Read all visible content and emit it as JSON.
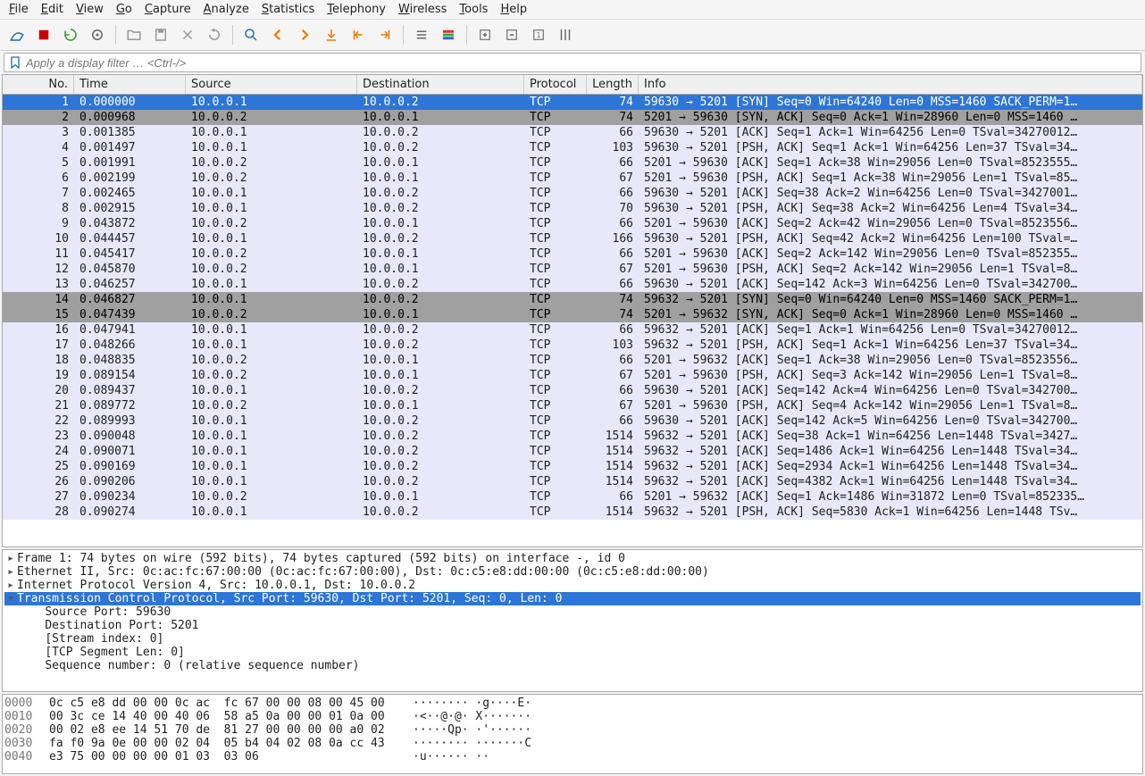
{
  "menubar": [
    "File",
    "Edit",
    "View",
    "Go",
    "Capture",
    "Analyze",
    "Statistics",
    "Telephony",
    "Wireless",
    "Tools",
    "Help"
  ],
  "filter_placeholder": "Apply a display filter … <Ctrl-/>",
  "columns": {
    "no": "No.",
    "time": "Time",
    "source": "Source",
    "destination": "Destination",
    "protocol": "Protocol",
    "length": "Length",
    "info": "Info"
  },
  "packets": [
    {
      "no": 1,
      "time": "0.000000",
      "src": "10.0.0.1",
      "dst": "10.0.0.2",
      "proto": "TCP",
      "len": 74,
      "info": "59630 → 5201 [SYN] Seq=0 Win=64240 Len=0 MSS=1460 SACK_PERM=1…",
      "style": "selected"
    },
    {
      "no": 2,
      "time": "0.000968",
      "src": "10.0.0.2",
      "dst": "10.0.0.1",
      "proto": "TCP",
      "len": 74,
      "info": "5201 → 59630 [SYN, ACK] Seq=0 Ack=1 Win=28960 Len=0 MSS=1460 …",
      "style": "syn"
    },
    {
      "no": 3,
      "time": "0.001385",
      "src": "10.0.0.1",
      "dst": "10.0.0.2",
      "proto": "TCP",
      "len": 66,
      "info": "59630 → 5201 [ACK] Seq=1 Ack=1 Win=64256 Len=0 TSval=34270012…",
      "style": "tcp"
    },
    {
      "no": 4,
      "time": "0.001497",
      "src": "10.0.0.1",
      "dst": "10.0.0.2",
      "proto": "TCP",
      "len": 103,
      "info": "59630 → 5201 [PSH, ACK] Seq=1 Ack=1 Win=64256 Len=37 TSval=34…",
      "style": "tcp"
    },
    {
      "no": 5,
      "time": "0.001991",
      "src": "10.0.0.2",
      "dst": "10.0.0.1",
      "proto": "TCP",
      "len": 66,
      "info": "5201 → 59630 [ACK] Seq=1 Ack=38 Win=29056 Len=0 TSval=8523555…",
      "style": "tcp"
    },
    {
      "no": 6,
      "time": "0.002199",
      "src": "10.0.0.2",
      "dst": "10.0.0.1",
      "proto": "TCP",
      "len": 67,
      "info": "5201 → 59630 [PSH, ACK] Seq=1 Ack=38 Win=29056 Len=1 TSval=85…",
      "style": "tcp"
    },
    {
      "no": 7,
      "time": "0.002465",
      "src": "10.0.0.1",
      "dst": "10.0.0.2",
      "proto": "TCP",
      "len": 66,
      "info": "59630 → 5201 [ACK] Seq=38 Ack=2 Win=64256 Len=0 TSval=3427001…",
      "style": "tcp"
    },
    {
      "no": 8,
      "time": "0.002915",
      "src": "10.0.0.1",
      "dst": "10.0.0.2",
      "proto": "TCP",
      "len": 70,
      "info": "59630 → 5201 [PSH, ACK] Seq=38 Ack=2 Win=64256 Len=4 TSval=34…",
      "style": "tcp"
    },
    {
      "no": 9,
      "time": "0.043872",
      "src": "10.0.0.2",
      "dst": "10.0.0.1",
      "proto": "TCP",
      "len": 66,
      "info": "5201 → 59630 [ACK] Seq=2 Ack=42 Win=29056 Len=0 TSval=8523556…",
      "style": "tcp"
    },
    {
      "no": 10,
      "time": "0.044457",
      "src": "10.0.0.1",
      "dst": "10.0.0.2",
      "proto": "TCP",
      "len": 166,
      "info": "59630 → 5201 [PSH, ACK] Seq=42 Ack=2 Win=64256 Len=100 TSval=…",
      "style": "tcp"
    },
    {
      "no": 11,
      "time": "0.045417",
      "src": "10.0.0.2",
      "dst": "10.0.0.1",
      "proto": "TCP",
      "len": 66,
      "info": "5201 → 59630 [ACK] Seq=2 Ack=142 Win=29056 Len=0 TSval=852355…",
      "style": "tcp"
    },
    {
      "no": 12,
      "time": "0.045870",
      "src": "10.0.0.2",
      "dst": "10.0.0.1",
      "proto": "TCP",
      "len": 67,
      "info": "5201 → 59630 [PSH, ACK] Seq=2 Ack=142 Win=29056 Len=1 TSval=8…",
      "style": "tcp"
    },
    {
      "no": 13,
      "time": "0.046257",
      "src": "10.0.0.1",
      "dst": "10.0.0.2",
      "proto": "TCP",
      "len": 66,
      "info": "59630 → 5201 [ACK] Seq=142 Ack=3 Win=64256 Len=0 TSval=342700…",
      "style": "tcp"
    },
    {
      "no": 14,
      "time": "0.046827",
      "src": "10.0.0.1",
      "dst": "10.0.0.2",
      "proto": "TCP",
      "len": 74,
      "info": "59632 → 5201 [SYN] Seq=0 Win=64240 Len=0 MSS=1460 SACK_PERM=1…",
      "style": "syn"
    },
    {
      "no": 15,
      "time": "0.047439",
      "src": "10.0.0.2",
      "dst": "10.0.0.1",
      "proto": "TCP",
      "len": 74,
      "info": "5201 → 59632 [SYN, ACK] Seq=0 Ack=1 Win=28960 Len=0 MSS=1460 …",
      "style": "syn"
    },
    {
      "no": 16,
      "time": "0.047941",
      "src": "10.0.0.1",
      "dst": "10.0.0.2",
      "proto": "TCP",
      "len": 66,
      "info": "59632 → 5201 [ACK] Seq=1 Ack=1 Win=64256 Len=0 TSval=34270012…",
      "style": "tcp"
    },
    {
      "no": 17,
      "time": "0.048266",
      "src": "10.0.0.1",
      "dst": "10.0.0.2",
      "proto": "TCP",
      "len": 103,
      "info": "59632 → 5201 [PSH, ACK] Seq=1 Ack=1 Win=64256 Len=37 TSval=34…",
      "style": "tcp"
    },
    {
      "no": 18,
      "time": "0.048835",
      "src": "10.0.0.2",
      "dst": "10.0.0.1",
      "proto": "TCP",
      "len": 66,
      "info": "5201 → 59632 [ACK] Seq=1 Ack=38 Win=29056 Len=0 TSval=8523556…",
      "style": "tcp"
    },
    {
      "no": 19,
      "time": "0.089154",
      "src": "10.0.0.2",
      "dst": "10.0.0.1",
      "proto": "TCP",
      "len": 67,
      "info": "5201 → 59630 [PSH, ACK] Seq=3 Ack=142 Win=29056 Len=1 TSval=8…",
      "style": "tcp"
    },
    {
      "no": 20,
      "time": "0.089437",
      "src": "10.0.0.1",
      "dst": "10.0.0.2",
      "proto": "TCP",
      "len": 66,
      "info": "59630 → 5201 [ACK] Seq=142 Ack=4 Win=64256 Len=0 TSval=342700…",
      "style": "tcp"
    },
    {
      "no": 21,
      "time": "0.089772",
      "src": "10.0.0.2",
      "dst": "10.0.0.1",
      "proto": "TCP",
      "len": 67,
      "info": "5201 → 59630 [PSH, ACK] Seq=4 Ack=142 Win=29056 Len=1 TSval=8…",
      "style": "tcp"
    },
    {
      "no": 22,
      "time": "0.089993",
      "src": "10.0.0.1",
      "dst": "10.0.0.2",
      "proto": "TCP",
      "len": 66,
      "info": "59630 → 5201 [ACK] Seq=142 Ack=5 Win=64256 Len=0 TSval=342700…",
      "style": "tcp"
    },
    {
      "no": 23,
      "time": "0.090048",
      "src": "10.0.0.1",
      "dst": "10.0.0.2",
      "proto": "TCP",
      "len": 1514,
      "info": "59632 → 5201 [ACK] Seq=38 Ack=1 Win=64256 Len=1448 TSval=3427…",
      "style": "tcp"
    },
    {
      "no": 24,
      "time": "0.090071",
      "src": "10.0.0.1",
      "dst": "10.0.0.2",
      "proto": "TCP",
      "len": 1514,
      "info": "59632 → 5201 [ACK] Seq=1486 Ack=1 Win=64256 Len=1448 TSval=34…",
      "style": "tcp"
    },
    {
      "no": 25,
      "time": "0.090169",
      "src": "10.0.0.1",
      "dst": "10.0.0.2",
      "proto": "TCP",
      "len": 1514,
      "info": "59632 → 5201 [ACK] Seq=2934 Ack=1 Win=64256 Len=1448 TSval=34…",
      "style": "tcp"
    },
    {
      "no": 26,
      "time": "0.090206",
      "src": "10.0.0.1",
      "dst": "10.0.0.2",
      "proto": "TCP",
      "len": 1514,
      "info": "59632 → 5201 [ACK] Seq=4382 Ack=1 Win=64256 Len=1448 TSval=34…",
      "style": "tcp"
    },
    {
      "no": 27,
      "time": "0.090234",
      "src": "10.0.0.2",
      "dst": "10.0.0.1",
      "proto": "TCP",
      "len": 66,
      "info": "5201 → 59632 [ACK] Seq=1 Ack=1486 Win=31872 Len=0 TSval=852335…",
      "style": "tcp"
    },
    {
      "no": 28,
      "time": "0.090274",
      "src": "10.0.0.1",
      "dst": "10.0.0.2",
      "proto": "TCP",
      "len": 1514,
      "info": "59632 → 5201 [PSH, ACK] Seq=5830 Ack=1 Win=64256 Len=1448 TSv…",
      "style": "tcp"
    }
  ],
  "details": [
    {
      "toggle": "▸",
      "indent": 0,
      "text": "Frame 1: 74 bytes on wire (592 bits), 74 bytes captured (592 bits) on interface -, id 0",
      "sel": false
    },
    {
      "toggle": "▸",
      "indent": 0,
      "text": "Ethernet II, Src: 0c:ac:fc:67:00:00 (0c:ac:fc:67:00:00), Dst: 0c:c5:e8:dd:00:00 (0c:c5:e8:dd:00:00)",
      "sel": false
    },
    {
      "toggle": "▸",
      "indent": 0,
      "text": "Internet Protocol Version 4, Src: 10.0.0.1, Dst: 10.0.0.2",
      "sel": false
    },
    {
      "toggle": "▾",
      "indent": 0,
      "text": "Transmission Control Protocol, Src Port: 59630, Dst Port: 5201, Seq: 0, Len: 0",
      "sel": true
    },
    {
      "toggle": "",
      "indent": 2,
      "text": "Source Port: 59630",
      "sel": false
    },
    {
      "toggle": "",
      "indent": 2,
      "text": "Destination Port: 5201",
      "sel": false
    },
    {
      "toggle": "",
      "indent": 2,
      "text": "[Stream index: 0]",
      "sel": false
    },
    {
      "toggle": "",
      "indent": 2,
      "text": "[TCP Segment Len: 0]",
      "sel": false
    },
    {
      "toggle": "",
      "indent": 2,
      "text": "Sequence number: 0    (relative sequence number)",
      "sel": false
    }
  ],
  "hex": [
    {
      "off": "0000",
      "bytes": "0c c5 e8 dd 00 00 0c ac  fc 67 00 00 08 00 45 00",
      "ascii": "········ ·g····E·"
    },
    {
      "off": "0010",
      "bytes": "00 3c ce 14 40 00 40 06  58 a5 0a 00 00 01 0a 00",
      "ascii": "·<··@·@· X·······"
    },
    {
      "off": "0020",
      "bytes": "00 02 e8 ee 14 51 70 de  81 27 00 00 00 00 a0 02",
      "ascii": "·····Qp· ·'······"
    },
    {
      "off": "0030",
      "bytes": "fa f0 9a 0e 00 00 02 04  05 b4 04 02 08 0a cc 43",
      "ascii": "········ ·······C"
    },
    {
      "off": "0040",
      "bytes": "e3 75 00 00 00 00 01 03  03 06",
      "ascii": "·u······ ··"
    }
  ]
}
